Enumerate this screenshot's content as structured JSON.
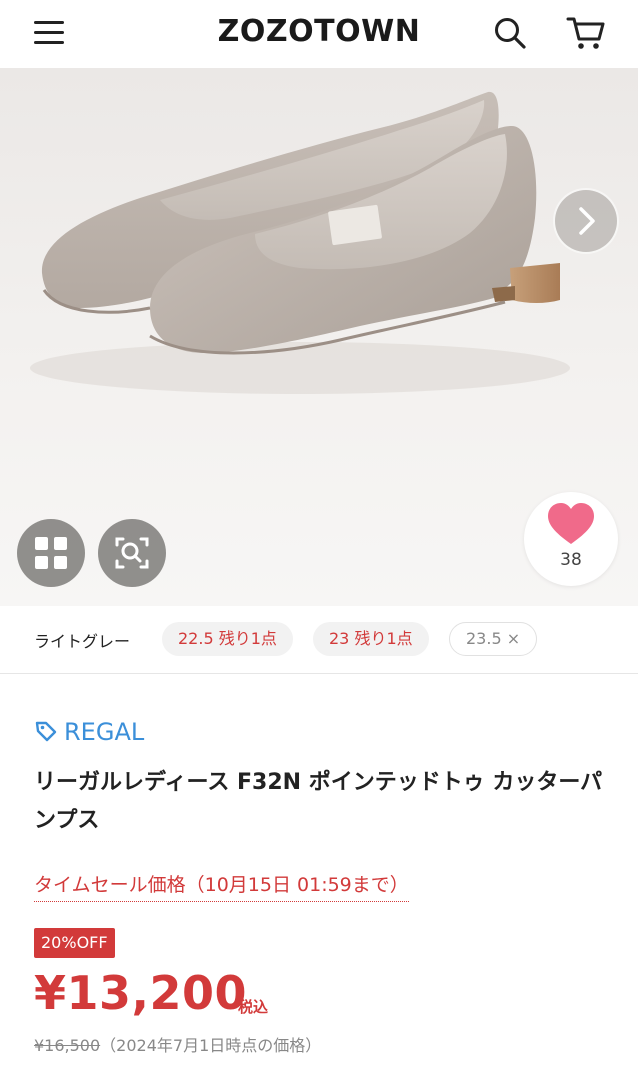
{
  "header": {
    "logo": "ZOZOTOWN"
  },
  "gallery": {
    "like_count": "38"
  },
  "variants": {
    "color": "ライトグレー",
    "sizes": [
      {
        "label": "22.5 残り1点",
        "status": "low"
      },
      {
        "label": "23 残り1点",
        "status": "low"
      },
      {
        "label": "23.5 ×",
        "status": "sold-out"
      }
    ]
  },
  "product": {
    "brand": "REGAL",
    "title": "リーガルレディース F32N ポインテッドトゥ カッターパンプス",
    "sale_label": "タイムセール価格（10月15日 01:59まで）",
    "discount": "20%OFF",
    "price": "¥13,200",
    "tax": "税込",
    "old_price": "¥16,500",
    "old_price_note": "（2024年7月1日時点の価格）"
  },
  "colors": {
    "accent_red": "#d23a3a",
    "brand_blue": "#3b8fd9",
    "like_pink": "#f06a8a"
  }
}
